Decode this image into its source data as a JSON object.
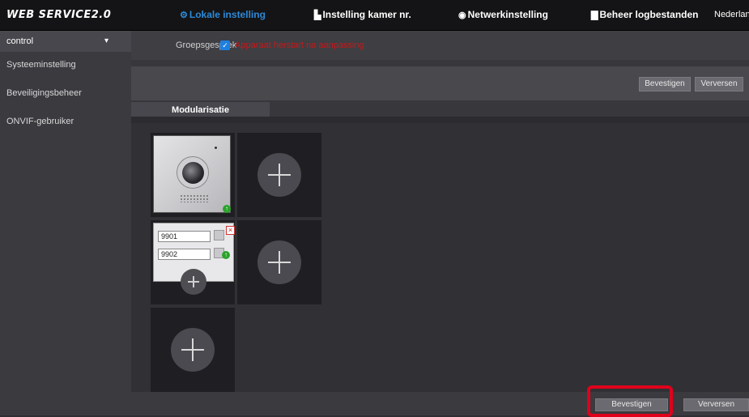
{
  "app": {
    "logo": "WEB SERVICE2.0"
  },
  "nav": {
    "tabs": [
      {
        "label": "Lokale instelling",
        "icon": "gear-icon",
        "active": true
      },
      {
        "label": "Instelling kamer nr.",
        "icon": "building-icon"
      },
      {
        "label": "Netwerkinstelling",
        "icon": "globe-icon"
      },
      {
        "label": "Beheer logbestanden",
        "icon": "document-icon"
      }
    ],
    "language": "Nederland"
  },
  "sidebar": {
    "items": [
      {
        "label": "control"
      },
      {
        "label": "Systeeminstelling"
      },
      {
        "label": "Beveiligingsbeheer"
      },
      {
        "label": "ONVIF-gebruiker"
      }
    ]
  },
  "group": {
    "label": "Groepsgesprek",
    "checked": true,
    "note": "Apparaat herstart na aanpassing"
  },
  "toolbar": {
    "confirm": "Bevestigen",
    "refresh": "Verversen"
  },
  "module_tab": "Modularisatie",
  "rooms": {
    "room1": "9901",
    "room2": "9902"
  },
  "bottom": {
    "confirm": "Bevestigen",
    "refresh": "Verversen"
  },
  "colors": {
    "accent": "#2b8ad8",
    "highlight": "#e0001b",
    "warning": "#c81818"
  }
}
